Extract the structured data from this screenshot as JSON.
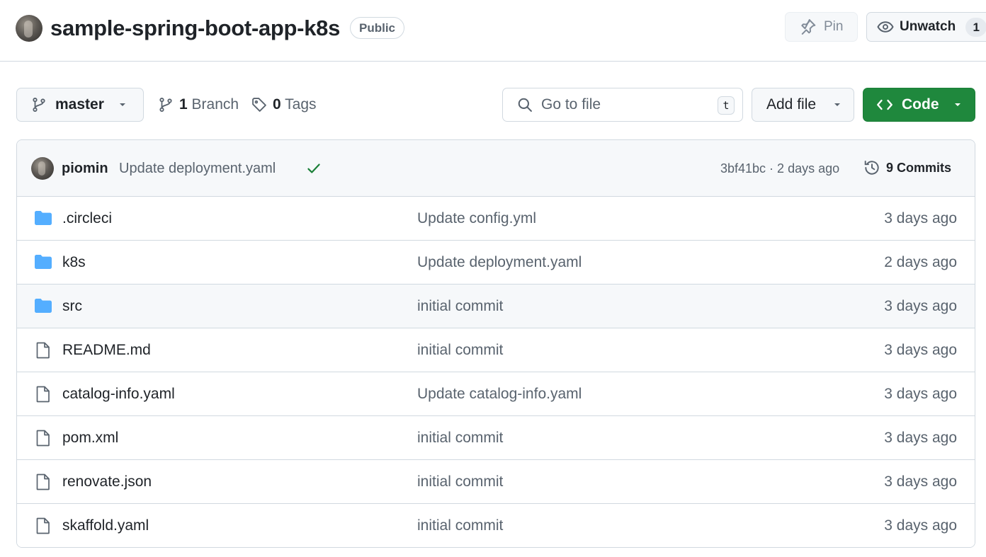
{
  "header": {
    "repo_name": "sample-spring-boot-app-k8s",
    "visibility": "Public",
    "pin_label": "Pin",
    "unwatch_label": "Unwatch",
    "watch_count": "1"
  },
  "toolbar": {
    "branch": "master",
    "branch_count": "1",
    "branch_label": "Branch",
    "tag_count": "0",
    "tag_label": "Tags",
    "search_placeholder": "Go to file",
    "search_shortcut": "t",
    "add_file_label": "Add file",
    "code_label": "Code"
  },
  "latest_commit": {
    "author": "piomin",
    "message": "Update deployment.yaml",
    "status": "success",
    "meta": "3bf41bc · 2 days ago",
    "commit_count": "9",
    "commits_label": "Commits"
  },
  "files": [
    {
      "type": "folder",
      "name": ".circleci",
      "message": "Update config.yml",
      "date": "3 days ago"
    },
    {
      "type": "folder",
      "name": "k8s",
      "message": "Update deployment.yaml",
      "date": "2 days ago"
    },
    {
      "type": "folder",
      "name": "src",
      "message": "initial commit",
      "date": "3 days ago"
    },
    {
      "type": "file",
      "name": "README.md",
      "message": "initial commit",
      "date": "3 days ago"
    },
    {
      "type": "file",
      "name": "catalog-info.yaml",
      "message": "Update catalog-info.yaml",
      "date": "3 days ago"
    },
    {
      "type": "file",
      "name": "pom.xml",
      "message": "initial commit",
      "date": "3 days ago"
    },
    {
      "type": "file",
      "name": "renovate.json",
      "message": "initial commit",
      "date": "3 days ago"
    },
    {
      "type": "file",
      "name": "skaffold.yaml",
      "message": "initial commit",
      "date": "3 days ago"
    }
  ],
  "colors": {
    "folder": "#54aeff",
    "code_button": "#1f883d",
    "success_check": "#1a7f37",
    "muted_text": "#59636e"
  }
}
